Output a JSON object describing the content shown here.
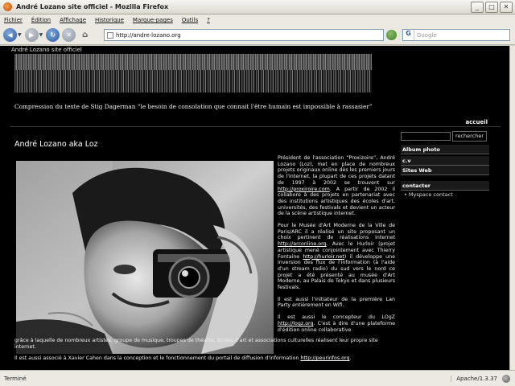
{
  "window": {
    "title": "André Lozano site officiel - Mozilla Firefox"
  },
  "menu": [
    "Fichier",
    "Édition",
    "Affichage",
    "Historique",
    "Marque-pages",
    "Outils",
    "?"
  ],
  "nav": {
    "url": "http://andre-lozano.org",
    "search_placeholder": "Google"
  },
  "page": {
    "site_name": "André Lozano site officiel",
    "tagline": "Compression du texte de Stig Dagerman “le besoin de consolation que connait l'être humain est impossible à rassasier”",
    "home_link": "accueil",
    "title": "André Lozano aka Loz",
    "bio": {
      "p1_a": "Président de l'association “Proxizoire”, André Lozano (Loz), met en place de nombreux projets originaux online dès les premiers jours de l'internet, la plupart de ces projets datant de 1997 à 2002 se trouvent sur ",
      "p1_link": "http://proxiroire.com",
      "p1_b": ". A partir de 2002 il collabore à des projets en partenariat avec des institutions artistiques des écoles d'art, universités, des festivals et devient un acteur de la scène artistique internet.",
      "p2_a": "Pour le Musée d'Art Moderne de la Ville de Paris/ARC il a réalisé un site proposant un choix pertinent de réalisations internet ",
      "p2_link1": "http://arconline.org",
      "p2_b": ". Avec le Hurloir (projet artistique mené conjointement avec Thierry Fontaine ",
      "p2_link2": "http://hurloir.net",
      "p2_c": ") il développe une inversion des flux de l'information (à l'aide d'un stream radio) du sud vers le nord ce projet a été présenté au musée d'Art Moderne, au Palais de Tokyo et dans plusieurs festivals.",
      "p3": "Il est aussi l'initiateur de la première Lan Party entièrement en Wifi.",
      "p4_a": "Il est aussi le concepteur du LOgZ ",
      "p4_link": "http://logz.org",
      "p4_b": ". C'est à dire d'une plateforme d'édition online collaborative"
    },
    "full": {
      "p1": "grâce à laquelle de nombreux artistes, groupe de musique, troupes de théatre, écoles d'art et associations culturelles réalisent leur propre site internet.",
      "p2_a": "Il est aussi associé à Xavier Cahen dans la conception et le fonctionnement du portail de diffusion d'information ",
      "p2_link": "http://peurinfos.org",
      "p2_b": "."
    }
  },
  "sidebar": {
    "search_button": "rechercher",
    "items": [
      "Album photo",
      "c.v",
      "Sites Web",
      "contacter"
    ],
    "link": "Myspace contact"
  },
  "status": {
    "text": "Terminé",
    "server": "Apache/1.3.37"
  }
}
